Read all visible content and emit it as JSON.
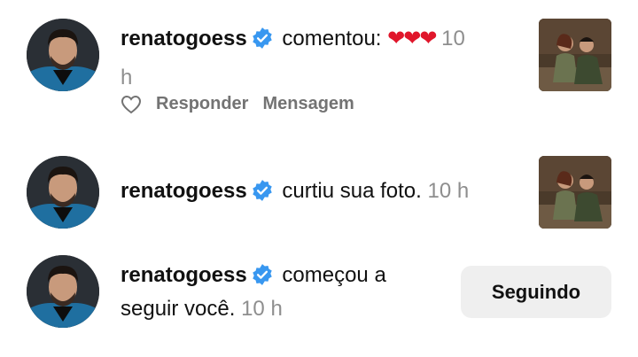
{
  "notifications": [
    {
      "username": "renatogoess",
      "action": "comentou:",
      "comment_hearts": "❤❤❤",
      "time": "10 h",
      "time_wrap": "10",
      "time_wrap_unit": "h",
      "actions": {
        "reply": "Responder",
        "message": "Mensagem"
      }
    },
    {
      "username": "renatogoess",
      "action": "curtiu sua foto.",
      "time": "10 h"
    },
    {
      "username": "renatogoess",
      "action_line1": "começou a",
      "action_line2": "seguir você.",
      "time": "10 h",
      "button": "Seguindo"
    }
  ],
  "colors": {
    "verified": "#3897f0",
    "heart": "#e0162b",
    "muted": "#8e8e8e",
    "button_bg": "#efefef"
  },
  "icons": [
    "verified-badge-icon",
    "heart-outline-icon"
  ]
}
